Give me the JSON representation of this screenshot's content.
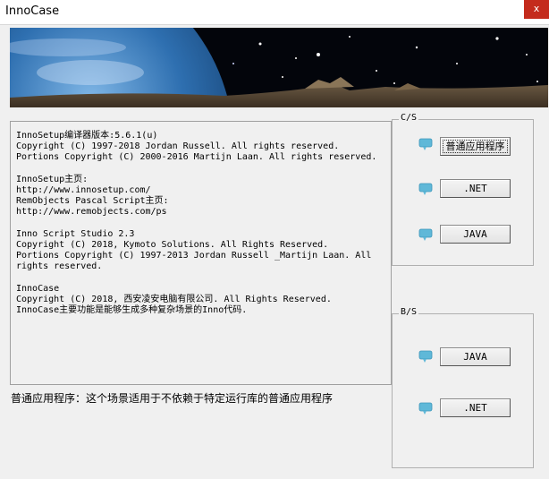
{
  "window": {
    "title": "InnoCase",
    "close_label": "x"
  },
  "info": {
    "text": "InnoSetup编译器版本:5.6.1(u)\nCopyright (C) 1997-2018 Jordan Russell. All rights reserved.\nPortions Copyright (C) 2000-2016 Martijn Laan. All rights reserved.\n\nInnoSetup主页:\nhttp://www.innosetup.com/\nRemObjects Pascal Script主页:\nhttp://www.remobjects.com/ps\n\nInno Script Studio 2.3\nCopyright (C) 2018, Kymoto Solutions. All Rights Reserved.\nPortions Copyright (C) 1997-2013 Jordan Russell _Martijn Laan. All rights reserved.\n\nInnoCase\nCopyright (C) 2018, 西安凌安电脑有限公司. All Rights Reserved.\nInnoCase主要功能是能够生成多种复杂场景的Inno代码."
  },
  "status": {
    "text": "普通应用程序：这个场景适用于不依赖于特定运行库的普通应用程序"
  },
  "cs_group": {
    "label": "C/S",
    "buttons": [
      "普通应用程序",
      ".NET",
      "JAVA"
    ]
  },
  "bs_group": {
    "label": "B/S",
    "buttons": [
      "JAVA",
      ".NET"
    ]
  },
  "icons": {
    "banner": "space-earth-banner",
    "bubble": "speech-bubble-icon",
    "bubble_color": "#5fb8d8"
  }
}
